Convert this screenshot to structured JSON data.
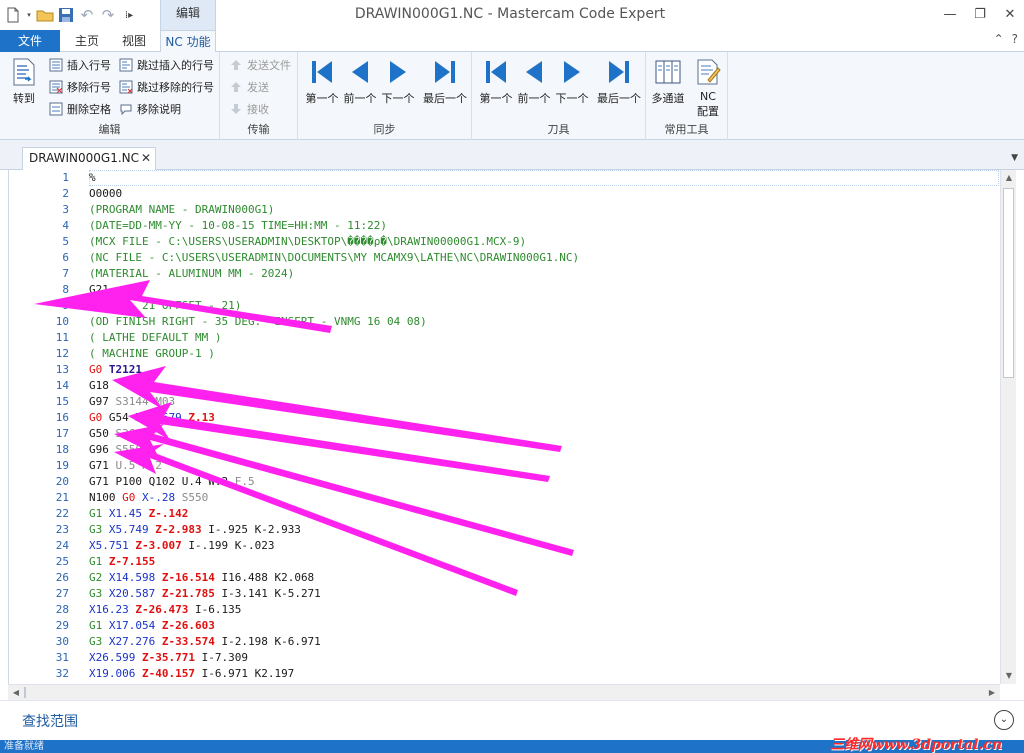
{
  "window": {
    "title": "DRAWIN000G1.NC - Mastercam Code Expert",
    "context_tab": "编辑"
  },
  "tabs": [
    {
      "label": "文件"
    },
    {
      "label": "主页"
    },
    {
      "label": "视图"
    },
    {
      "label": "NC 功能"
    }
  ],
  "ribbon": {
    "edit": {
      "label": "编辑",
      "goto": "转到",
      "insert_line_numbers": "插入行号",
      "remove_line_numbers": "移除行号",
      "delete_spaces": "删除空格",
      "skip_insert_line_numbers": "跳过插入的行号",
      "skip_remove_line_numbers": "跳过移除的行号",
      "remove_comments": "移除说明"
    },
    "transfer": {
      "label": "传输",
      "send_file": "发送文件",
      "send": "发送",
      "receive": "接收"
    },
    "sync": {
      "label": "同步",
      "first": "第一个",
      "prev": "前一个",
      "next": "下一个",
      "last": "最后一个"
    },
    "tool": {
      "label": "刀具",
      "first": "第一个",
      "prev": "前一个",
      "next": "下一个",
      "last": "最后一个"
    },
    "common": {
      "label": "常用工具",
      "multichannel": "多通道",
      "nc_config_1": "NC",
      "nc_config_2": "配置"
    }
  },
  "document_tab": {
    "label": "DRAWIN000G1.NC"
  },
  "editor": {
    "lines": [
      {
        "n": "1",
        "tokens": [
          [
            "%",
            "black"
          ]
        ]
      },
      {
        "n": "2",
        "tokens": [
          [
            "O0000",
            "black"
          ]
        ]
      },
      {
        "n": "3",
        "tokens": [
          [
            "(PROGRAM NAME - DRAWIN000G1)",
            "green"
          ]
        ]
      },
      {
        "n": "4",
        "tokens": [
          [
            "(DATE=DD-MM-YY - 10-08-15 TIME=HH:MM - 11:22)",
            "green"
          ]
        ]
      },
      {
        "n": "5",
        "tokens": [
          [
            "(MCX FILE - C:\\USERS\\USERADMIN\\DESKTOP\\����ρ�\\DRAWIN00000G1.MCX-9)",
            "green"
          ]
        ]
      },
      {
        "n": "6",
        "tokens": [
          [
            "(NC FILE - C:\\USERS\\USERADMIN\\DOCUMENTS\\MY MCAMX9\\LATHE\\NC\\DRAWIN000G1.NC)",
            "green"
          ]
        ]
      },
      {
        "n": "7",
        "tokens": [
          [
            "(MATERIAL - ALUMINUM MM - 2024)",
            "green"
          ]
        ]
      },
      {
        "n": "8",
        "tokens": [
          [
            "G21",
            "black"
          ]
        ]
      },
      {
        "n": "9",
        "tokens": [
          [
            "(TOOL - 21 OFFSET - 21)",
            "green"
          ]
        ]
      },
      {
        "n": "10",
        "tokens": [
          [
            "(OD FINISH RIGHT - 35 DEG.  INSERT - VNMG 16 04 08)",
            "green"
          ]
        ]
      },
      {
        "n": "11",
        "tokens": [
          [
            "( LATHE DEFAULT MM )",
            "green"
          ]
        ]
      },
      {
        "n": "12",
        "tokens": [
          [
            "( MACHINE GROUP-1 )",
            "green"
          ]
        ]
      },
      {
        "n": "13",
        "tokens": [
          [
            "G0 ",
            "red"
          ],
          [
            "T2121",
            "purple"
          ]
        ]
      },
      {
        "n": "14",
        "tokens": [
          [
            "G18",
            "black"
          ]
        ]
      },
      {
        "n": "15",
        "tokens": [
          [
            "G97 ",
            "black"
          ],
          [
            "S3144 M03",
            "gray"
          ]
        ]
      },
      {
        "n": "16",
        "tokens": [
          [
            "G0 ",
            "red"
          ],
          [
            "G54 ",
            "black"
          ],
          [
            "X57.679 ",
            "blue"
          ],
          [
            "Z.13",
            "dkred"
          ]
        ]
      },
      {
        "n": "17",
        "tokens": [
          [
            "G50 ",
            "black"
          ],
          [
            "S3600",
            "gray"
          ]
        ]
      },
      {
        "n": "18",
        "tokens": [
          [
            "G96 ",
            "black"
          ],
          [
            "S550",
            "gray"
          ]
        ]
      },
      {
        "n": "19",
        "tokens": [
          [
            "G71 ",
            "black"
          ],
          [
            "U.5 R.2",
            "gray"
          ]
        ]
      },
      {
        "n": "20",
        "tokens": [
          [
            "G71 P100 Q102 U.4 W.2 ",
            "black"
          ],
          [
            "F.5",
            "gray"
          ]
        ]
      },
      {
        "n": "21",
        "tokens": [
          [
            "N100 ",
            "black"
          ],
          [
            "G0 ",
            "red"
          ],
          [
            "X-.28 ",
            "blue"
          ],
          [
            "S550",
            "gray"
          ]
        ]
      },
      {
        "n": "22",
        "tokens": [
          [
            "G1 ",
            "green"
          ],
          [
            "X1.45 ",
            "blue"
          ],
          [
            "Z-.142",
            "dkred"
          ]
        ]
      },
      {
        "n": "23",
        "tokens": [
          [
            "G3 ",
            "green"
          ],
          [
            "X5.749 ",
            "blue"
          ],
          [
            "Z-2.983 ",
            "dkred"
          ],
          [
            "I-.925 K-2.933",
            "black"
          ]
        ]
      },
      {
        "n": "24",
        "tokens": [
          [
            "X5.751 ",
            "blue"
          ],
          [
            "Z-3.007 ",
            "dkred"
          ],
          [
            "I-.199 K-.023",
            "black"
          ]
        ]
      },
      {
        "n": "25",
        "tokens": [
          [
            "G1 ",
            "green"
          ],
          [
            "Z-7.155",
            "dkred"
          ]
        ]
      },
      {
        "n": "26",
        "tokens": [
          [
            "G2 ",
            "green"
          ],
          [
            "X14.598 ",
            "blue"
          ],
          [
            "Z-16.514 ",
            "dkred"
          ],
          [
            "I16.488 K2.068",
            "black"
          ]
        ]
      },
      {
        "n": "27",
        "tokens": [
          [
            "G3 ",
            "green"
          ],
          [
            "X20.587 ",
            "blue"
          ],
          [
            "Z-21.785 ",
            "dkred"
          ],
          [
            "I-3.141 K-5.271",
            "black"
          ]
        ]
      },
      {
        "n": "28",
        "tokens": [
          [
            "X16.23 ",
            "blue"
          ],
          [
            "Z-26.473 ",
            "dkred"
          ],
          [
            "I-6.135",
            "black"
          ]
        ]
      },
      {
        "n": "29",
        "tokens": [
          [
            "G1 ",
            "green"
          ],
          [
            "X17.054 ",
            "blue"
          ],
          [
            "Z-26.603",
            "dkred"
          ]
        ]
      },
      {
        "n": "30",
        "tokens": [
          [
            "G3 ",
            "green"
          ],
          [
            "X27.276 ",
            "blue"
          ],
          [
            "Z-33.574 ",
            "dkred"
          ],
          [
            "I-2.198 K-6.971",
            "black"
          ]
        ]
      },
      {
        "n": "31",
        "tokens": [
          [
            "X26.599 ",
            "blue"
          ],
          [
            "Z-35.771 ",
            "dkred"
          ],
          [
            "I-7.309",
            "black"
          ]
        ]
      },
      {
        "n": "32",
        "tokens": [
          [
            "X19.006 ",
            "blue"
          ],
          [
            "Z-40.157 ",
            "dkred"
          ],
          [
            "I-6.971 K2.197",
            "black"
          ]
        ]
      }
    ]
  },
  "find_panel": {
    "label": "查找范围"
  },
  "status": {
    "text": "准备就绪",
    "watermark": "三维网www.3dportal.cn"
  },
  "colors": {
    "accent": "#1e73c8",
    "annotation_arrow": "#ff22ee"
  }
}
